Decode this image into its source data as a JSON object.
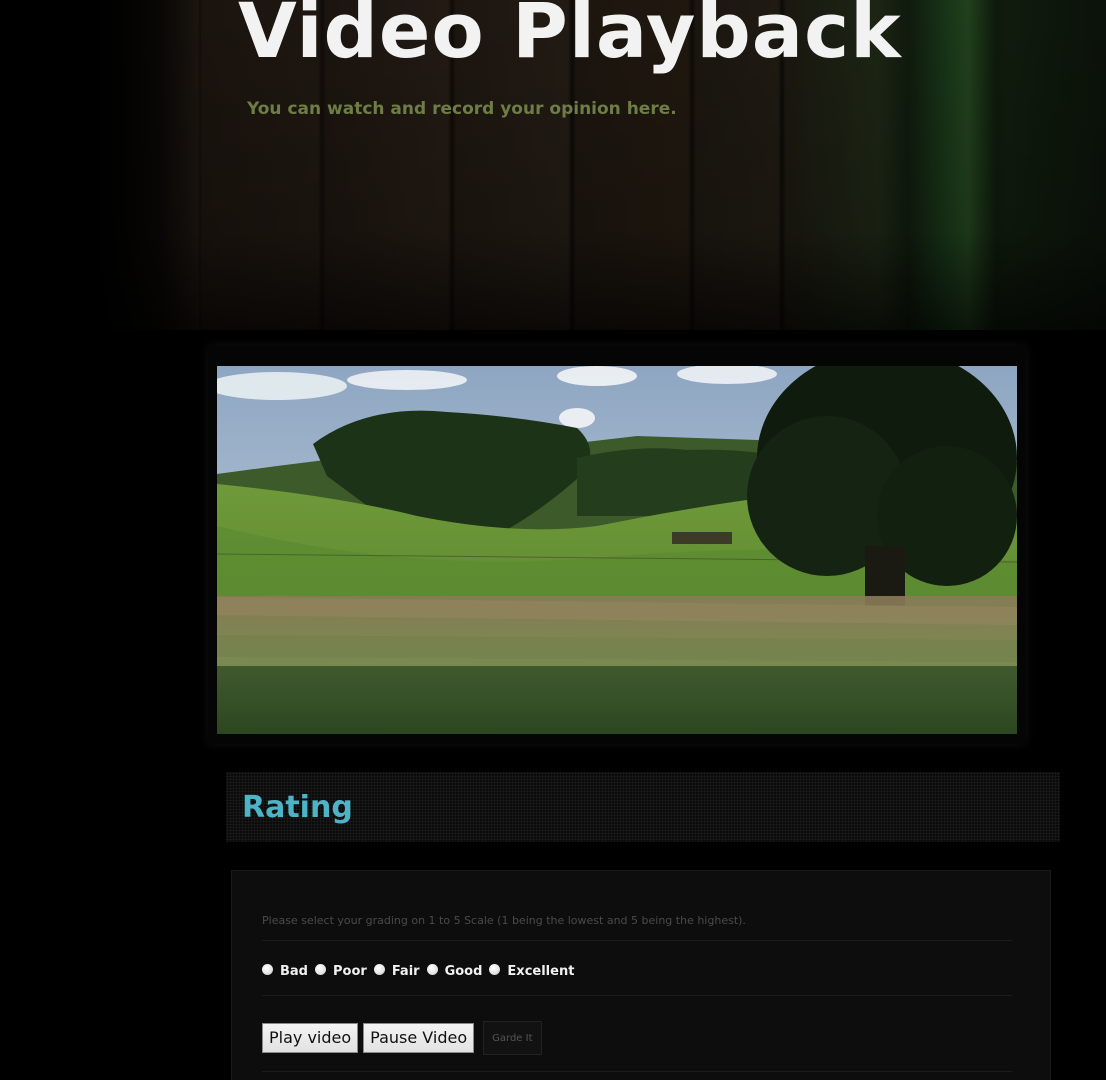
{
  "header": {
    "title": "Video Playback",
    "subtitle": "You can watch and record your opinion here."
  },
  "video": {
    "description_icon": "video-still-landscape"
  },
  "rating": {
    "title": "Rating",
    "instructions": "Please select your grading on 1 to 5 Scale (1 being the lowest and 5 being the highest).",
    "options": [
      {
        "label": "Bad"
      },
      {
        "label": "Poor"
      },
      {
        "label": "Fair"
      },
      {
        "label": "Good"
      },
      {
        "label": "Excellent"
      }
    ],
    "buttons": {
      "play_label": "Play video",
      "pause_label": "Pause Video",
      "grade_label": "Garde It"
    }
  },
  "colors": {
    "title": "#f2f2f2",
    "subtitle": "#6e7d45",
    "rating_title": "#4fb3c8",
    "background": "#000000"
  }
}
